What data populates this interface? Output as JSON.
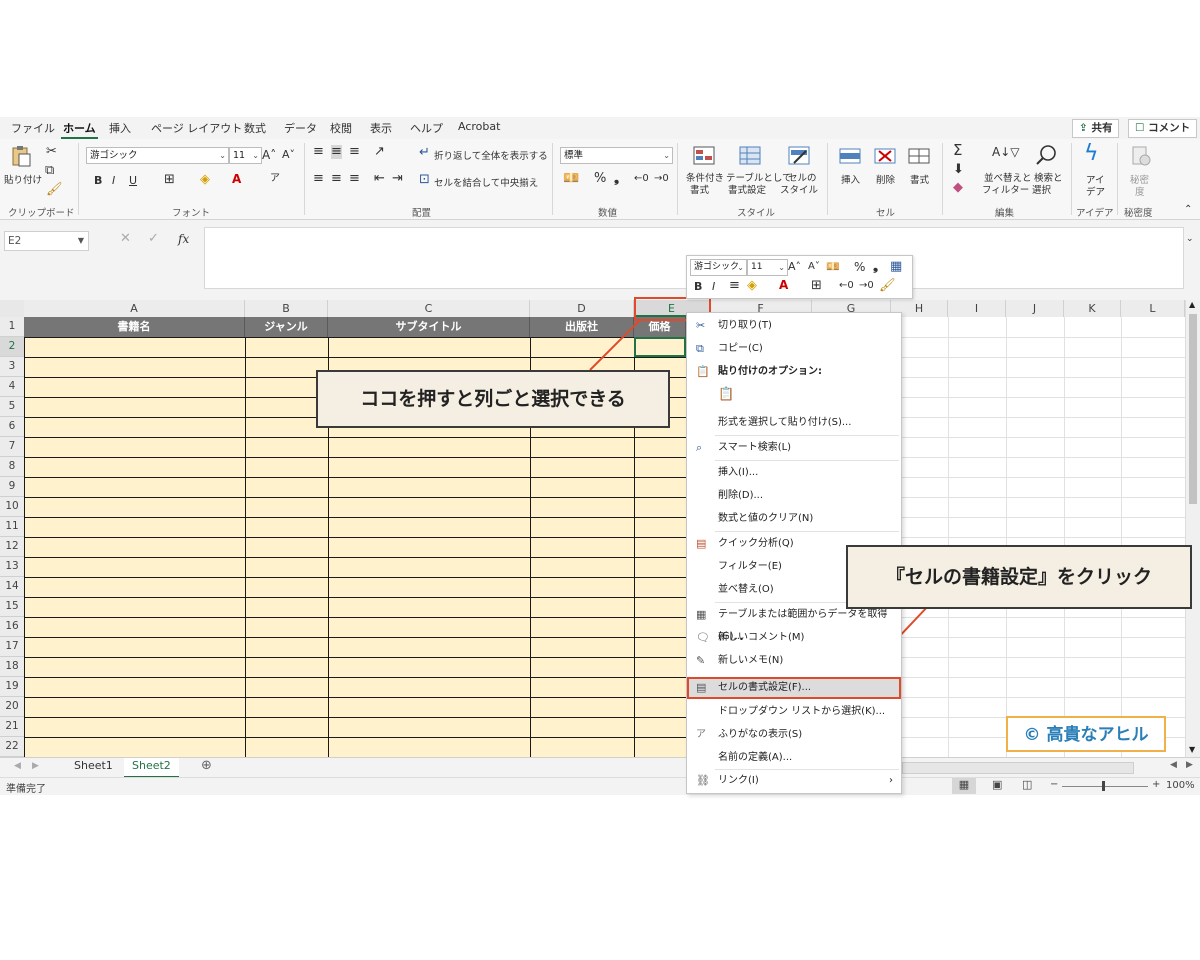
{
  "ribbon_tabs": [
    "ファイル",
    "ホーム",
    "挿入",
    "ページ レイアウト",
    "数式",
    "データ",
    "校閲",
    "表示",
    "ヘルプ",
    "Acrobat"
  ],
  "share_label": "共有",
  "comment_label": "コメント",
  "clipboard": {
    "paste": "貼り付け",
    "group": "クリップボード"
  },
  "font": {
    "name": "游ゴシック",
    "size": "11",
    "group": "フォント"
  },
  "alignment": {
    "wrap": "折り返して全体を表示する",
    "merge": "セルを結合して中央揃え",
    "group": "配置"
  },
  "number": {
    "format": "標準",
    "group": "数値"
  },
  "styles": {
    "cond1": "条件付き",
    "cond2": "書式",
    "table1": "テーブルとして",
    "table2": "書式設定",
    "cell1": "セルの",
    "cell2": "スタイル",
    "group": "スタイル"
  },
  "cells": {
    "insert": "挿入",
    "delete": "削除",
    "format": "書式",
    "group": "セル"
  },
  "editing": {
    "sort1": "並べ替えと",
    "sort2": "フィルター",
    "find1": "検索と",
    "find2": "選択",
    "group": "編集"
  },
  "ideas": {
    "l1": "アイ",
    "l2": "デア",
    "group": "アイデア"
  },
  "sensitivity": {
    "l1": "秘密",
    "l2": "度",
    "group": "秘密度"
  },
  "name_box": "E2",
  "columns": [
    "A",
    "B",
    "C",
    "D",
    "E",
    "F",
    "G",
    "H",
    "I",
    "J",
    "K",
    "L"
  ],
  "rows": [
    "1",
    "2",
    "3",
    "4",
    "5",
    "6",
    "7",
    "8",
    "9",
    "10",
    "11",
    "12",
    "13",
    "14",
    "15",
    "16",
    "17",
    "18",
    "19",
    "20",
    "21",
    "22"
  ],
  "header_row": [
    "書籍名",
    "ジャンル",
    "サブタイトル",
    "出版社",
    "価格"
  ],
  "mini_toolbar": {
    "font": "游ゴシック",
    "size": "11"
  },
  "context_menu": {
    "cut": "切り取り(T)",
    "copy": "コピー(C)",
    "paste_options": "貼り付けのオプション:",
    "paste_special": "形式を選択して貼り付け(S)...",
    "smart_lookup": "スマート検索(L)",
    "insert": "挿入(I)...",
    "delete": "削除(D)...",
    "clear": "数式と値のクリア(N)",
    "quick_analysis": "クイック分析(Q)",
    "filter": "フィルター(E)",
    "sort": "並べ替え(O)",
    "table_data": "テーブルまたは範囲からデータを取得(G)...",
    "new_comment": "新しいコメント(M)",
    "new_note": "新しいメモ(N)",
    "format_cells": "セルの書式設定(F)...",
    "dropdown": "ドロップダウン リストから選択(K)...",
    "phonetic": "ふりがなの表示(S)",
    "define_name": "名前の定義(A)...",
    "link": "リンク(I)"
  },
  "sheets": [
    "Sheet1",
    "Sheet2"
  ],
  "status_text": "準備完了",
  "zoom": "100%",
  "callouts": {
    "column_select": "ココを押すと列ごと選択できる",
    "format_click": "『セルの書籍設定』をクリック",
    "copyright": "© 高貴なアヒル"
  },
  "colors": {
    "accent": "#217346",
    "fill": "#fff2cc",
    "header_fill": "#767676",
    "callout_border": "#e04a2a",
    "copyright": "#2a7fb8"
  }
}
